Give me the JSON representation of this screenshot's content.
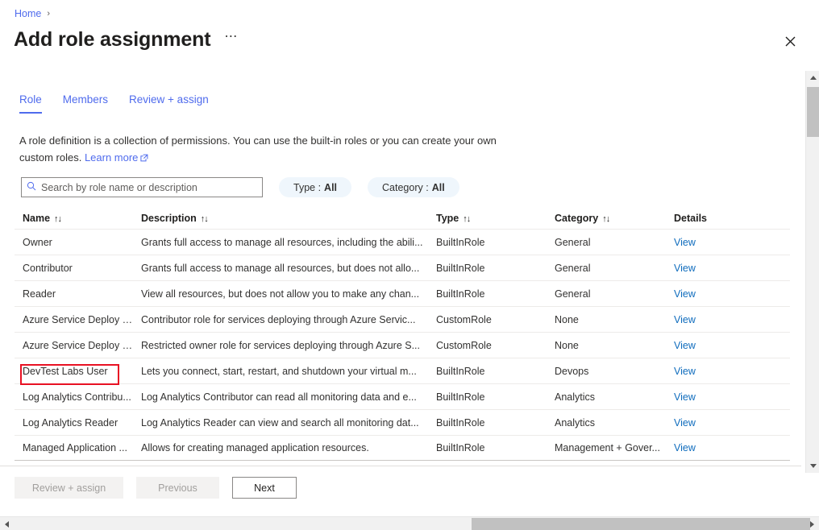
{
  "breadcrumb": {
    "home": "Home",
    "separator": "›"
  },
  "header": {
    "title": "Add role assignment",
    "more_label": "⋯",
    "close_label": "Close"
  },
  "tabs": [
    {
      "label": "Role",
      "active": true
    },
    {
      "label": "Members",
      "active": false
    },
    {
      "label": "Review + assign",
      "active": false
    }
  ],
  "description": {
    "text": "A role definition is a collection of permissions. You can use the built-in roles or you can create your own custom roles.",
    "link_label": "Learn more"
  },
  "search": {
    "placeholder": "Search by role name or description",
    "value": "",
    "icon": "search-icon"
  },
  "filters": [
    {
      "label": "Type :",
      "value": "All"
    },
    {
      "label": "Category :",
      "value": "All"
    }
  ],
  "table": {
    "columns": [
      {
        "label": "Name",
        "sortable": true
      },
      {
        "label": "Description",
        "sortable": true
      },
      {
        "label": "Type",
        "sortable": true
      },
      {
        "label": "Category",
        "sortable": true
      },
      {
        "label": "Details",
        "sortable": false
      }
    ],
    "sort_icon": "↑↓",
    "details_link_label": "View",
    "rows": [
      {
        "name": "Owner",
        "description": "Grants full access to manage all resources, including the abili...",
        "type": "BuiltInRole",
        "category": "General",
        "details": "View",
        "highlighted": false
      },
      {
        "name": "Contributor",
        "description": "Grants full access to manage all resources, but does not allo...",
        "type": "BuiltInRole",
        "category": "General",
        "details": "View",
        "highlighted": false
      },
      {
        "name": "Reader",
        "description": "View all resources, but does not allow you to make any chan...",
        "type": "BuiltInRole",
        "category": "General",
        "details": "View",
        "highlighted": false
      },
      {
        "name": "Azure Service Deploy R...",
        "description": "Contributor role for services deploying through Azure Servic...",
        "type": "CustomRole",
        "category": "None",
        "details": "View",
        "highlighted": false
      },
      {
        "name": "Azure Service Deploy R...",
        "description": "Restricted owner role for services deploying through Azure S...",
        "type": "CustomRole",
        "category": "None",
        "details": "View",
        "highlighted": false
      },
      {
        "name": "DevTest Labs User",
        "description": "Lets you connect, start, restart, and shutdown your virtual m...",
        "type": "BuiltInRole",
        "category": "Devops",
        "details": "View",
        "highlighted": true
      },
      {
        "name": "Log Analytics Contribu...",
        "description": "Log Analytics Contributor can read all monitoring data and e...",
        "type": "BuiltInRole",
        "category": "Analytics",
        "details": "View",
        "highlighted": false
      },
      {
        "name": "Log Analytics Reader",
        "description": "Log Analytics Reader can view and search all monitoring dat...",
        "type": "BuiltInRole",
        "category": "Analytics",
        "details": "View",
        "highlighted": false
      },
      {
        "name": "Managed Application ...",
        "description": "Allows for creating managed application resources.",
        "type": "BuiltInRole",
        "category": "Management + Gover...",
        "details": "View",
        "highlighted": false
      }
    ]
  },
  "footer": {
    "review_label": "Review + assign",
    "previous_label": "Previous",
    "next_label": "Next"
  },
  "colors": {
    "accent": "#4f6bed",
    "link": "#0f6cbd",
    "pill_bg": "#eff6fc",
    "highlight_border": "#e81123",
    "disabled_button_bg": "#f3f2f1",
    "disabled_button_text": "#a19f9d"
  }
}
